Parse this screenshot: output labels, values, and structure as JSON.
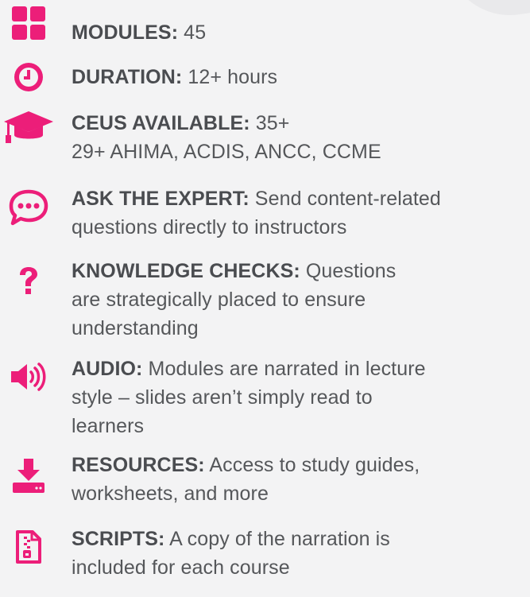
{
  "features": [
    {
      "icon": "modules-grid-icon",
      "label": "MODULES:",
      "lines": [
        " 45"
      ]
    },
    {
      "icon": "clock-icon",
      "label": "DURATION:",
      "lines": [
        " 12+ hours"
      ]
    },
    {
      "icon": "graduation-cap-icon",
      "label": "CEUS AVAILABLE:",
      "lines": [
        " 35+",
        "29+ AHIMA, ACDIS, ANCC, CCME"
      ]
    },
    {
      "icon": "chat-bubble-icon",
      "label": "ASK THE EXPERT:",
      "lines": [
        " Send content-related",
        "questions directly to instructors"
      ]
    },
    {
      "icon": "question-mark-icon",
      "label": "KNOWLEDGE CHECKS:",
      "lines": [
        " Questions",
        "are strategically placed to ensure",
        "understanding"
      ]
    },
    {
      "icon": "speaker-icon",
      "label": "AUDIO:",
      "lines": [
        " Modules are narrated in lecture",
        "style – slides aren’t simply read to",
        "learners"
      ]
    },
    {
      "icon": "download-icon",
      "label": "RESOURCES:",
      "lines": [
        " Access to study guides,",
        "worksheets, and more"
      ]
    },
    {
      "icon": "zip-file-icon",
      "label": "SCRIPTS:",
      "lines": [
        " A copy of the narration is",
        "included for each course"
      ]
    }
  ],
  "colors": {
    "accent": "#ec1e79",
    "text": "#55575a",
    "background": "#f3f3f4"
  }
}
